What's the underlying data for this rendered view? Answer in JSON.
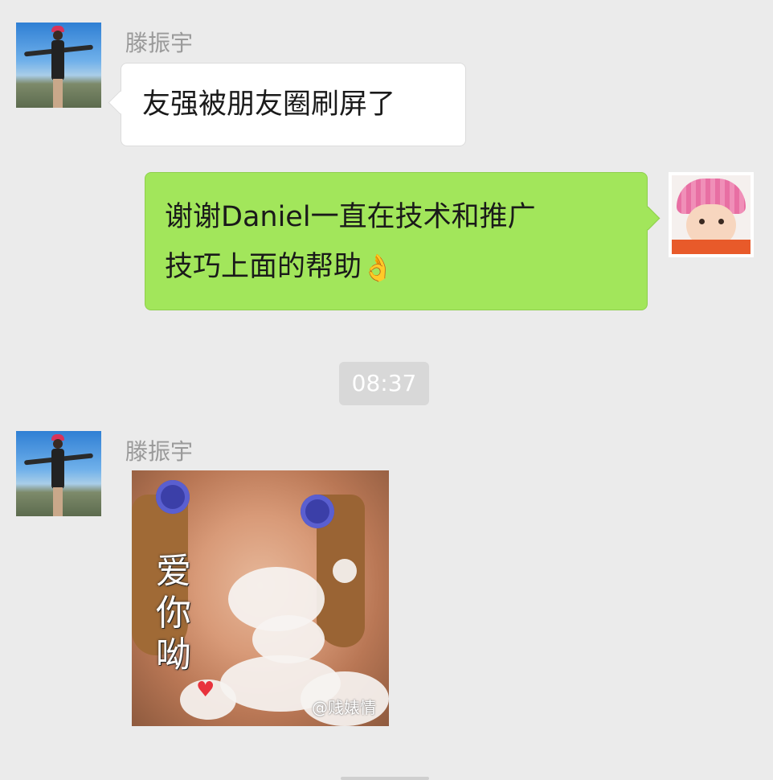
{
  "messages": [
    {
      "sender": "滕振宇",
      "direction": "incoming",
      "text": "友强被朋友圈刷屏了"
    },
    {
      "direction": "outgoing",
      "text_line1": "谢谢Daniel一直在技术和推广",
      "text_line2": "技巧上面的帮助",
      "emoji": "👌"
    }
  ],
  "timestamp": "08:37",
  "sticker_message": {
    "sender": "滕振宇",
    "caption": "爱你呦",
    "watermark": "@贱婊情",
    "icon": "sticker-image"
  },
  "colors": {
    "background": "#ebebeb",
    "incoming_bubble": "#ffffff",
    "outgoing_bubble": "#a2e65b",
    "sender_name": "#9a9a9a"
  }
}
